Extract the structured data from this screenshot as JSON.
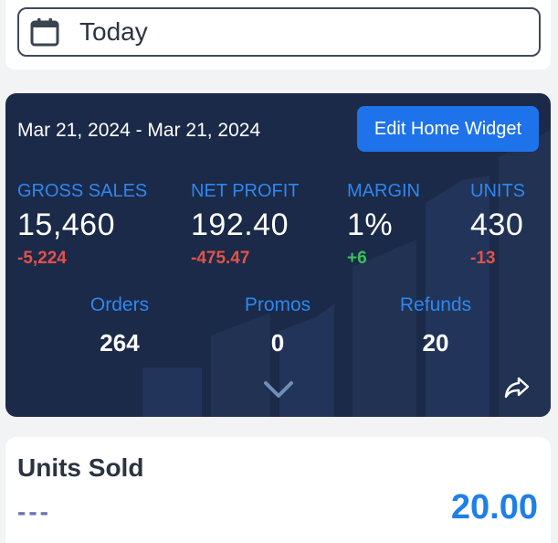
{
  "date_selector": {
    "label": "Today",
    "icon": "calendar-icon"
  },
  "widget": {
    "date_range": "Mar 21, 2024 - Mar 21, 2024",
    "edit_button_label": "Edit Home Widget",
    "metrics": [
      {
        "label": "GROSS SALES",
        "value": "15,460",
        "delta": "-5,224",
        "delta_trend": "negative"
      },
      {
        "label": "NET PROFIT",
        "value": "192.40",
        "delta": "-475.47",
        "delta_trend": "negative"
      },
      {
        "label": "MARGIN",
        "value": "1%",
        "delta": "+6",
        "delta_trend": "positive"
      },
      {
        "label": "UNITS",
        "value": "430",
        "delta": "-13",
        "delta_trend": "negative"
      }
    ],
    "sub_metrics": [
      {
        "label": "Orders",
        "value": "264"
      },
      {
        "label": "Promos",
        "value": "0"
      },
      {
        "label": "Refunds",
        "value": "20"
      }
    ],
    "expand_icon": "chevron-down-icon",
    "share_icon": "share-icon",
    "colors": {
      "background": "#1b2a48",
      "accent": "#1e73ea",
      "negative": "#e2524a",
      "positive": "#36c25a"
    }
  },
  "units_sold": {
    "title": "Units Sold",
    "indicator": "---",
    "value": "20.00"
  }
}
